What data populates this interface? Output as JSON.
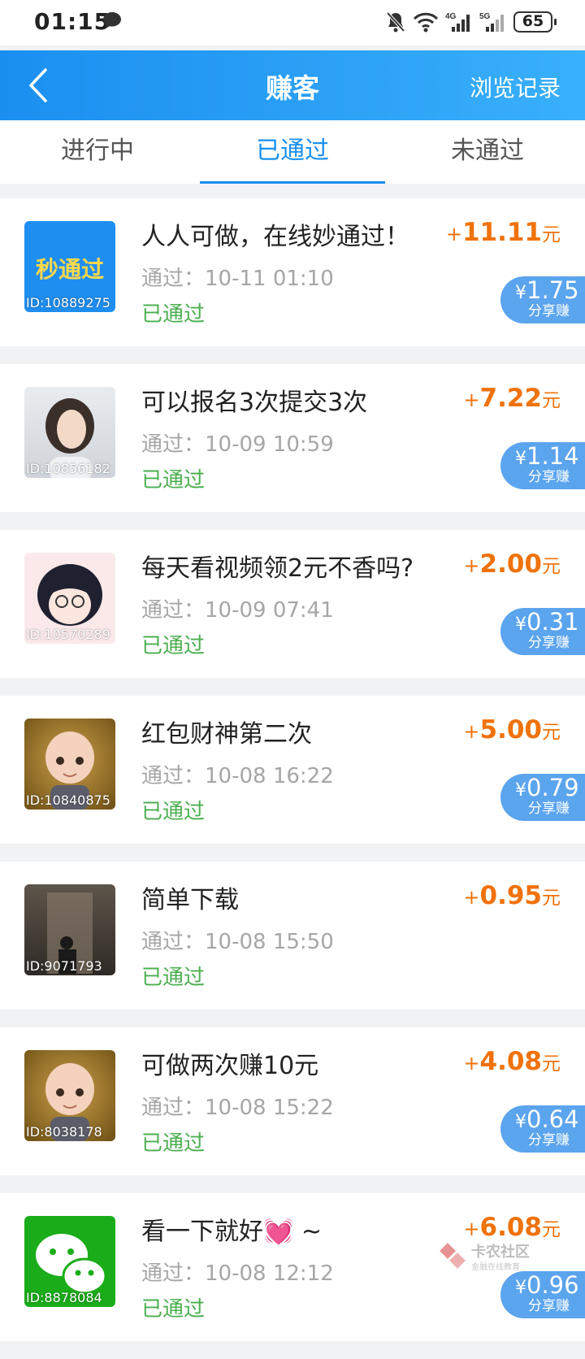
{
  "status_bar": {
    "time": "01:15",
    "battery": "65",
    "net1": "4G",
    "net2": "5G"
  },
  "header": {
    "back_icon": "chevron-left-icon",
    "title": "赚客",
    "history": "浏览记录"
  },
  "tabs": [
    {
      "label": "进行中",
      "active": false
    },
    {
      "label": "已通过",
      "active": true
    },
    {
      "label": "未通过",
      "active": false
    }
  ],
  "currency": "¥",
  "share_label": "分享赚",
  "tasks": [
    {
      "title": "人人可做，在线妙通过！",
      "time": "通过：10-11 01:10",
      "status": "已通过",
      "plus": "+",
      "amount": "11.11",
      "unit": "元",
      "share": "1.75",
      "id": "ID:10889275",
      "thumb_text": "秒通过"
    },
    {
      "title": "可以报名3次提交3次",
      "time": "通过：10-09 10:59",
      "status": "已通过",
      "plus": "+",
      "amount": "7.22",
      "unit": "元",
      "share": "1.14",
      "id": "ID:10856182"
    },
    {
      "title": "每天看视频领2元不香吗?",
      "time": "通过：10-09 07:41",
      "status": "已通过",
      "plus": "+",
      "amount": "2.00",
      "unit": "元",
      "share": "0.31",
      "id": "ID:10570289"
    },
    {
      "title": "红包财神第二次",
      "time": "通过：10-08 16:22",
      "status": "已通过",
      "plus": "+",
      "amount": "5.00",
      "unit": "元",
      "share": "0.79",
      "id": "ID:10840875"
    },
    {
      "title": "简单下载",
      "time": "通过：10-08 15:50",
      "status": "已通过",
      "plus": "+",
      "amount": "0.95",
      "unit": "元",
      "share": "",
      "id": "ID:9071793"
    },
    {
      "title": "可做两次赚10元",
      "time": "通过：10-08 15:22",
      "status": "已通过",
      "plus": "+",
      "amount": "4.08",
      "unit": "元",
      "share": "0.64",
      "id": "ID:8038178"
    },
    {
      "title": "看一下就好💓 ~",
      "time": "通过：10-08 12:12",
      "status": "已通过",
      "plus": "+",
      "amount": "6.08",
      "unit": "元",
      "share": "0.96",
      "id": "ID:8878084"
    }
  ],
  "watermark": {
    "name": "卡农社区",
    "sub": "金融在线教育"
  }
}
